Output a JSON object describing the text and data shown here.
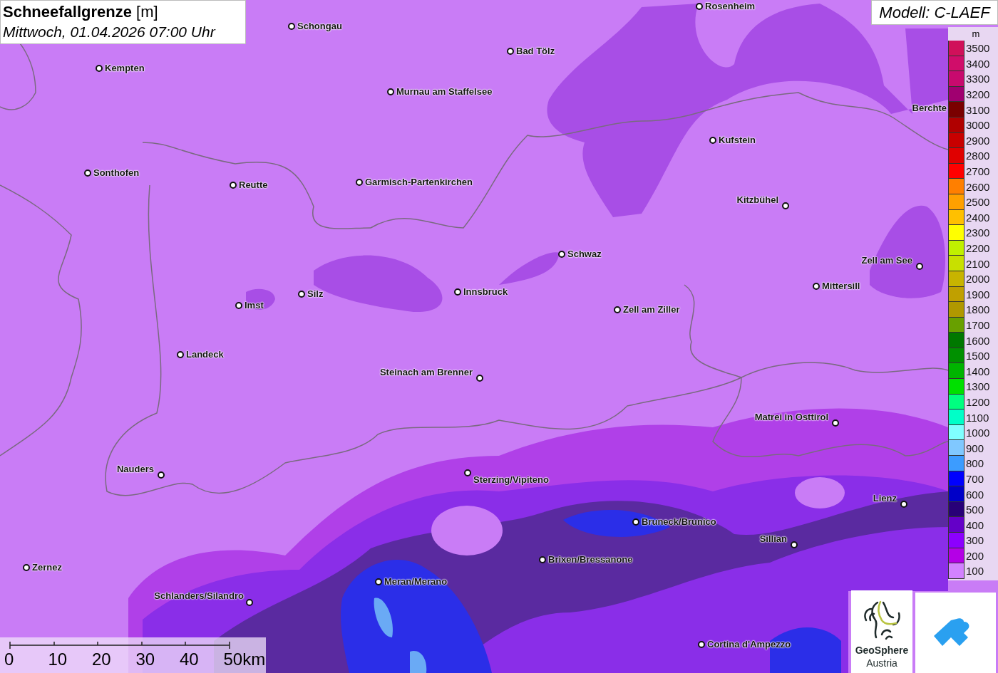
{
  "title": {
    "text": "**Schneefallgrenze** [m]",
    "subtitle": "Mittwoch, 01.04.2026 07:00 Uhr"
  },
  "model": "Modell: C-LAEF",
  "cities": [
    {
      "name": "Rosenheim"
    },
    {
      "name": "Schongau"
    },
    {
      "name": "Bad Tölz"
    },
    {
      "name": "Kempten"
    },
    {
      "name": "Murnau am Staffelsee"
    },
    {
      "name": "Berchte"
    },
    {
      "name": "Kufstein"
    },
    {
      "name": "Sonthofen"
    },
    {
      "name": "Reutte"
    },
    {
      "name": "Garmisch-Partenkirchen"
    },
    {
      "name": "Kitzbühel"
    },
    {
      "name": "Schwaz"
    },
    {
      "name": "Zell am See"
    },
    {
      "name": "Mittersill"
    },
    {
      "name": "Innsbruck"
    },
    {
      "name": "Silz"
    },
    {
      "name": "Imst"
    },
    {
      "name": "Zell am Ziller"
    },
    {
      "name": "Landeck"
    },
    {
      "name": "Steinach am Brenner"
    },
    {
      "name": "Matrei in Osttirol"
    },
    {
      "name": "Nauders"
    },
    {
      "name": "Sterzing/Vipiteno"
    },
    {
      "name": "Lienz"
    },
    {
      "name": "Bruneck/Brunico"
    },
    {
      "name": "Sillian"
    },
    {
      "name": "Brixen/Bressanone"
    },
    {
      "name": "Zernez"
    },
    {
      "name": "Meran/Merano"
    },
    {
      "name": "Schlanders/Silandro"
    },
    {
      "name": "Cortina d'Ampezzo"
    }
  ],
  "legend": {
    "unit": "m",
    "steps": [
      {
        "label": "3500",
        "color": "#d0105a"
      },
      {
        "label": "3400",
        "color": "#d00d6a"
      },
      {
        "label": "3300",
        "color": "#c80a6e"
      },
      {
        "label": "3200",
        "color": "#a00070"
      },
      {
        "label": "3100",
        "color": "#7a0000"
      },
      {
        "label": "3000",
        "color": "#b00000"
      },
      {
        "label": "2900",
        "color": "#c80000"
      },
      {
        "label": "2800",
        "color": "#e00000"
      },
      {
        "label": "2700",
        "color": "#ff0000"
      },
      {
        "label": "2600",
        "color": "#ff7f00"
      },
      {
        "label": "2500",
        "color": "#ffa000"
      },
      {
        "label": "2400",
        "color": "#ffc000"
      },
      {
        "label": "2300",
        "color": "#ffff00"
      },
      {
        "label": "2200",
        "color": "#c0f000"
      },
      {
        "label": "2100",
        "color": "#c8e000"
      },
      {
        "label": "2000",
        "color": "#c8b400"
      },
      {
        "label": "1900",
        "color": "#c0a000"
      },
      {
        "label": "1800",
        "color": "#b09800"
      },
      {
        "label": "1700",
        "color": "#68a000"
      },
      {
        "label": "1600",
        "color": "#007800"
      },
      {
        "label": "1500",
        "color": "#009000"
      },
      {
        "label": "1400",
        "color": "#00b400"
      },
      {
        "label": "1300",
        "color": "#00e000"
      },
      {
        "label": "1200",
        "color": "#00ff80"
      },
      {
        "label": "1100",
        "color": "#00ffc8"
      },
      {
        "label": "1000",
        "color": "#80ffff"
      },
      {
        "label": "900",
        "color": "#80c8ff"
      },
      {
        "label": "800",
        "color": "#3c9cff"
      },
      {
        "label": "700",
        "color": "#0000ff"
      },
      {
        "label": "600",
        "color": "#0000c8"
      },
      {
        "label": "500",
        "color": "#280078"
      },
      {
        "label": "400",
        "color": "#6400c8"
      },
      {
        "label": "300",
        "color": "#8c00ff"
      },
      {
        "label": "200",
        "color": "#b400e6"
      },
      {
        "label": "100",
        "color": "#d282ff"
      }
    ]
  },
  "scale": [
    "0",
    "10",
    "20",
    "30",
    "40",
    "50km"
  ],
  "logos": {
    "geosphere": {
      "name": "GeoSphere",
      "sub": "Austria"
    }
  }
}
